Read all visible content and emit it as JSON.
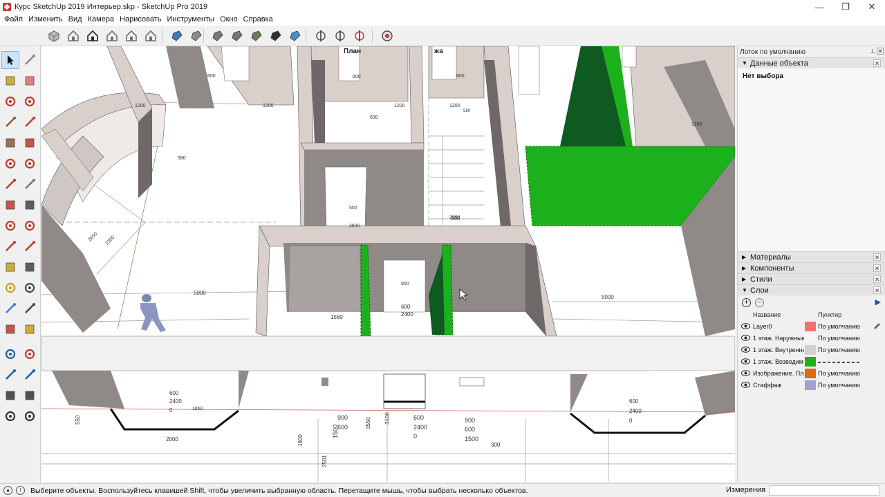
{
  "window": {
    "title": "Курс SketchUp 2019 Интерьер.skp - SketchUp Pro 2019",
    "minimize": "—",
    "maximize": "❐",
    "close": "✕"
  },
  "menu": [
    "Файл",
    "Изменить",
    "Вид",
    "Камера",
    "Нарисовать",
    "Инструменты",
    "Окно",
    "Справка"
  ],
  "toolbar": {
    "icons": [
      "iso-view-icon",
      "top-view-icon",
      "front-view-icon",
      "right-view-icon",
      "back-view-icon",
      "left-view-icon",
      "xray-icon",
      "back-edges-icon",
      "wireframe-icon",
      "hidden-line-icon",
      "shaded-icon",
      "shaded-textures-icon",
      "monochrome-icon",
      "section-plane-icon",
      "section-cuts-icon",
      "section-fill-icon",
      "geo-location-icon"
    ]
  },
  "palette": {
    "tools": [
      "select-tool-icon",
      "make-component-icon",
      "paint-bucket-icon",
      "eraser-icon",
      "line-tool-icon",
      "freehand-tool-icon",
      "rectangle-tool-icon",
      "rotated-rectangle-icon",
      "circle-tool-icon",
      "polygon-tool-icon",
      "arc-tool-icon",
      "arc-3point-icon",
      "pie-tool-icon",
      "arc-2point-icon",
      "move-tool-icon",
      "push-pull-icon",
      "rotate-tool-icon",
      "follow-me-icon",
      "scale-tool-icon",
      "offset-tool-icon",
      "tape-measure-icon",
      "dimension-tool-icon",
      "protractor-icon",
      "text-tool-icon",
      "axes-tool-icon",
      "3d-text-icon",
      "orbit-tool-icon",
      "pan-tool-icon",
      "zoom-tool-icon",
      "zoom-window-icon",
      "zoom-extents-icon",
      "previous-view-icon",
      "position-camera-icon",
      "look-around-icon",
      "walk-tool-icon",
      "section-plane-tool-icon"
    ]
  },
  "viewport": {
    "plan_label": "План",
    "plan_label_suffix": "жа",
    "dims": [
      "600",
      "600",
      "600",
      "1200",
      "1200",
      "1200",
      "1200",
      "580",
      "600",
      "580",
      "2650",
      "2300",
      "500",
      "2600",
      "900",
      "2000",
      "1560",
      "900",
      "600",
      "2400",
      "5000",
      "5000",
      "600",
      "2400",
      "0",
      "1650",
      "550",
      "2000",
      "900",
      "600",
      "1500",
      "3550",
      "3100",
      "600",
      "2400",
      "0",
      "900",
      "600",
      "1500",
      "300",
      "600",
      "2400",
      "0",
      "1600",
      "2501",
      "1200"
    ]
  },
  "tray": {
    "title": "Лоток по умолчанию",
    "entity_info": {
      "label": "Данные объекта",
      "value": "Нет выбора"
    },
    "panels": [
      "Материалы",
      "Компоненты",
      "Стили",
      "Слои"
    ],
    "layers": {
      "col_name": "Название",
      "col_dash": "Пунктир",
      "rows": [
        {
          "name": "Layer0",
          "color": "#f2726a",
          "dash": "По умолчанию",
          "current": true
        },
        {
          "name": "1 этаж. Наружные",
          "color": "#f5f5f5",
          "dash": "По умолчанию",
          "current": false
        },
        {
          "name": "1 этаж. Внутренни",
          "color": "#d6cfcb",
          "dash": "По умолчанию",
          "current": false
        },
        {
          "name": "1 этаж. Возводим",
          "color": "#1db01d",
          "dash": "",
          "current": false
        },
        {
          "name": "Изображение. Пла",
          "color": "#e06a0e",
          "dash": "По умолчанию",
          "current": false
        },
        {
          "name": "Стаффаж",
          "color": "#a1a1d4",
          "dash": "По умолчанию",
          "current": false
        }
      ]
    }
  },
  "status": {
    "hint": "Выберите объекты. Воспользуйтесь клавишей Shift, чтобы увеличить выбранную область. Перетащите мышь, чтобы выбрать несколько объектов.",
    "measure_label": "Измерения",
    "measure_value": ""
  },
  "colors": {
    "wall_top": "#d9cfcb",
    "wall_face": "#8f8a88",
    "green": "#1db01d",
    "dark_green": "#0e5a20"
  }
}
